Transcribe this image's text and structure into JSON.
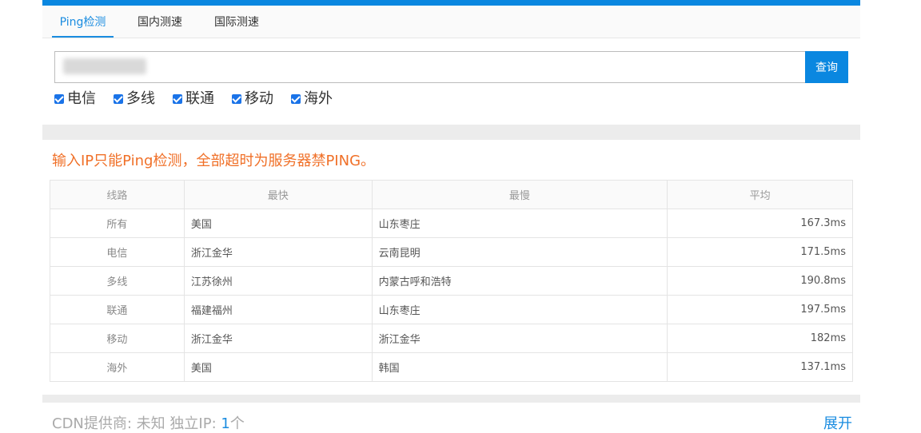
{
  "tabs": [
    {
      "label": "Ping检测",
      "active": true
    },
    {
      "label": "国内测速",
      "active": false
    },
    {
      "label": "国际测速",
      "active": false
    }
  ],
  "search": {
    "button_label": "查询"
  },
  "checkboxes": [
    {
      "label": "电信",
      "checked": true
    },
    {
      "label": "多线",
      "checked": true
    },
    {
      "label": "联通",
      "checked": true
    },
    {
      "label": "移动",
      "checked": true
    },
    {
      "label": "海外",
      "checked": true
    }
  ],
  "notice": "输入IP只能Ping检测，全部超时为服务器禁PING。",
  "table": {
    "headers": [
      "线路",
      "最快",
      "最慢",
      "平均"
    ],
    "rows": [
      {
        "line": "所有",
        "fastest": "美国",
        "slowest": "山东枣庄",
        "avg": "167.3ms"
      },
      {
        "line": "电信",
        "fastest": "浙江金华",
        "slowest": "云南昆明",
        "avg": "171.5ms"
      },
      {
        "line": "多线",
        "fastest": "江苏徐州",
        "slowest": "内蒙古呼和浩特",
        "avg": "190.8ms"
      },
      {
        "line": "联通",
        "fastest": "福建福州",
        "slowest": "山东枣庄",
        "avg": "197.5ms"
      },
      {
        "line": "移动",
        "fastest": "浙江金华",
        "slowest": "浙江金华",
        "avg": "182ms"
      },
      {
        "line": "海外",
        "fastest": "美国",
        "slowest": "韩国",
        "avg": "137.1ms"
      }
    ]
  },
  "footer": {
    "cdn_label": "CDN提供商: 未知 独立IP: ",
    "ip_count": "1",
    "ip_unit": "个",
    "expand_label": "展开"
  },
  "colors": {
    "accent": "#0a87e0",
    "notice": "#f07028",
    "checkbox": "#1a73e8"
  }
}
